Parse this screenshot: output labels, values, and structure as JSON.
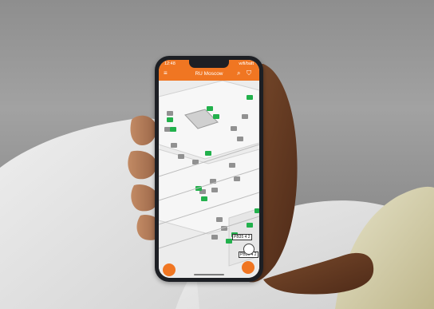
{
  "status_bar": {
    "time": "12:48",
    "signal_text": "wifi/batt"
  },
  "app": {
    "title": "RU Moscow"
  },
  "labels": {
    "desk_label_1": "PB35 4 2",
    "desk_label_2": "PB35 4 2"
  },
  "icons": {
    "menu": "menu-icon",
    "search": "search-icon",
    "filter": "filter-icon",
    "locate": "locate-icon"
  },
  "colors": {
    "accent": "#f07622",
    "desk_available": "#22b14c",
    "desk_unavailable": "#8c8c8c"
  }
}
